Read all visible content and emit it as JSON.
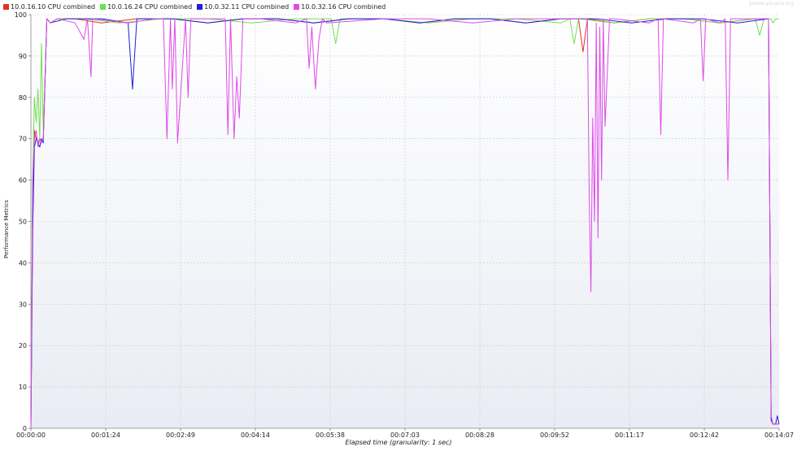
{
  "watermark": "jmeter-plugins.org",
  "chart_data": {
    "type": "line",
    "xlabel": "Elapsed time (granularity: 1 sec)",
    "ylabel": "Performance Metrics",
    "ylim": [
      0,
      100
    ],
    "yticks": [
      0,
      10,
      20,
      30,
      40,
      50,
      60,
      70,
      80,
      90,
      100
    ],
    "xlim_seconds": [
      0,
      847
    ],
    "xtick_labels": [
      "00:00:00",
      "00:01:24",
      "00:02:49",
      "00:04:14",
      "00:05:38",
      "00:07:03",
      "00:08:28",
      "00:09:52",
      "00:11:17",
      "00:12:42",
      "00:14:07"
    ],
    "grid": true,
    "legend_position": "top-left",
    "series": [
      {
        "name": "10.0.16.10 CPU combined",
        "color": "#e83020",
        "x": [
          0,
          2,
          4,
          6,
          8,
          10,
          12,
          14,
          18,
          22,
          30,
          50,
          80,
          120,
          160,
          200,
          240,
          280,
          320,
          360,
          400,
          440,
          480,
          520,
          560,
          600,
          620,
          625,
          630,
          660,
          700,
          740,
          780,
          820,
          835,
          838,
          840,
          843,
          847
        ],
        "y": [
          0,
          50,
          72,
          70,
          69,
          70,
          69,
          70,
          99,
          98,
          99,
          99,
          98,
          99,
          99,
          98,
          99,
          99,
          98,
          99,
          99,
          98,
          99,
          99,
          98,
          99,
          99,
          91,
          99,
          98,
          99,
          99,
          98,
          99,
          99,
          2,
          1,
          1,
          1
        ]
      },
      {
        "name": "10.0.16.24 CPU combined",
        "color": "#70e050",
        "x": [
          0,
          2,
          4,
          6,
          8,
          10,
          12,
          14,
          18,
          22,
          30,
          60,
          100,
          150,
          200,
          250,
          300,
          340,
          345,
          350,
          400,
          450,
          500,
          550,
          600,
          610,
          615,
          620,
          660,
          700,
          740,
          780,
          820,
          825,
          830,
          835,
          838,
          840,
          843,
          847
        ],
        "y": [
          0,
          60,
          80,
          74,
          82,
          70,
          93,
          72,
          99,
          98,
          99,
          99,
          98,
          99,
          99,
          98,
          99,
          99,
          93,
          99,
          99,
          98,
          99,
          99,
          98,
          99,
          93,
          99,
          98,
          99,
          99,
          98,
          99,
          95,
          99,
          99,
          99,
          98,
          99,
          99
        ]
      },
      {
        "name": "10.0.32.11 CPU combined",
        "color": "#1a20d8",
        "x": [
          0,
          2,
          4,
          6,
          8,
          10,
          12,
          14,
          18,
          22,
          40,
          80,
          110,
          115,
          120,
          160,
          200,
          240,
          280,
          320,
          360,
          400,
          440,
          480,
          520,
          560,
          600,
          640,
          680,
          720,
          760,
          800,
          835,
          838,
          840,
          843,
          845,
          847
        ],
        "y": [
          0,
          48,
          68,
          70,
          69,
          68,
          70,
          69,
          99,
          98,
          99,
          99,
          98,
          82,
          99,
          99,
          98,
          99,
          99,
          98,
          99,
          99,
          98,
          99,
          99,
          98,
          99,
          99,
          98,
          99,
          99,
          98,
          99,
          2,
          1,
          1,
          3,
          1
        ]
      },
      {
        "name": "10.0.32.16 CPU combined",
        "color": "#dd4ae8",
        "x": [
          0,
          2,
          4,
          6,
          8,
          10,
          12,
          14,
          18,
          22,
          30,
          50,
          60,
          64,
          68,
          70,
          110,
          140,
          150,
          154,
          158,
          160,
          163,
          166,
          175,
          178,
          181,
          190,
          220,
          223,
          226,
          230,
          233,
          236,
          240,
          260,
          300,
          312,
          315,
          318,
          322,
          326,
          330,
          335,
          400,
          450,
          500,
          550,
          620,
          630,
          632,
          634,
          636,
          638,
          640,
          642,
          644,
          646,
          648,
          650,
          655,
          660,
          700,
          710,
          713,
          716,
          750,
          758,
          761,
          764,
          780,
          786,
          789,
          792,
          800,
          835,
          838,
          840,
          843,
          845,
          847
        ],
        "y": [
          0,
          60,
          70,
          72,
          68,
          70,
          69,
          70,
          99,
          98,
          99,
          98,
          94,
          99,
          85,
          99,
          98,
          99,
          99,
          70,
          99,
          82,
          99,
          69,
          99,
          80,
          99,
          99,
          99,
          71,
          99,
          70,
          85,
          75,
          99,
          99,
          98,
          99,
          87,
          97,
          82,
          94,
          99,
          98,
          99,
          99,
          98,
          99,
          99,
          99,
          56,
          33,
          75,
          50,
          98,
          46,
          97,
          60,
          99,
          73,
          99,
          99,
          98,
          99,
          71,
          99,
          98,
          99,
          84,
          99,
          98,
          99,
          60,
          99,
          99,
          99,
          3,
          1,
          1,
          1,
          1
        ]
      }
    ]
  }
}
